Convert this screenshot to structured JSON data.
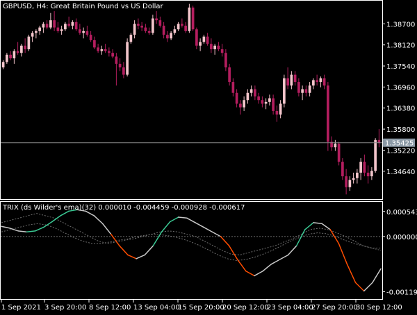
{
  "window": {
    "symbol_title": "GBPUSD, H4:  Great Britain Pound vs US Dollar",
    "indicator_title": "TRIX (ds Wilder's ema)(32) 0.000010 -0.004459 -0.000928 -0.000617"
  },
  "colors": {
    "background": "#000000",
    "frame": "#ffffff",
    "text": "#ffffff",
    "bull_candle": "#f4c6cc",
    "bear_candle": "#b51e5f",
    "bid_line": "#8c8c8c",
    "bid_label_bg": "#8c9aa6",
    "trix_up": "#3ac893",
    "trix_down": "#ff4d00",
    "trix_neutral": "#c8c8c8",
    "levels": "#6e6e6e"
  },
  "chart_data": [
    {
      "type": "candlestick",
      "title": "GBPUSD, H4:  Great Britain Pound vs US Dollar",
      "ylim": [
        1.3389,
        1.393
      ],
      "y_ticks": [
        "1.38700",
        "1.38120",
        "1.37540",
        "1.36960",
        "1.36380",
        "1.35800",
        "1.35220",
        "1.34640"
      ],
      "current_price": "1.35425",
      "candles_ohlc": [
        [
          1.375,
          1.377,
          1.3745,
          1.3765
        ],
        [
          1.3765,
          1.379,
          1.376,
          1.3785
        ],
        [
          1.3785,
          1.3795,
          1.377,
          1.3775
        ],
        [
          1.3775,
          1.38,
          1.376,
          1.3795
        ],
        [
          1.3795,
          1.382,
          1.3785,
          1.379
        ],
        [
          1.379,
          1.3815,
          1.378,
          1.381
        ],
        [
          1.381,
          1.383,
          1.379,
          1.38
        ],
        [
          1.38,
          1.384,
          1.3795,
          1.3835
        ],
        [
          1.3835,
          1.385,
          1.382,
          1.3845
        ],
        [
          1.3845,
          1.3855,
          1.383,
          1.385
        ],
        [
          1.385,
          1.3865,
          1.384,
          1.386
        ],
        [
          1.386,
          1.3875,
          1.3845,
          1.387
        ],
        [
          1.387,
          1.388,
          1.3855,
          1.386
        ],
        [
          1.386,
          1.39,
          1.3855,
          1.388
        ],
        [
          1.388,
          1.3905,
          1.385,
          1.386
        ],
        [
          1.386,
          1.3875,
          1.3845,
          1.385
        ],
        [
          1.385,
          1.3865,
          1.384,
          1.3855
        ],
        [
          1.3855,
          1.3875,
          1.385,
          1.387
        ],
        [
          1.387,
          1.389,
          1.386,
          1.3865
        ],
        [
          1.3865,
          1.388,
          1.3855,
          1.3875
        ],
        [
          1.3875,
          1.3885,
          1.385,
          1.3855
        ],
        [
          1.3855,
          1.387,
          1.384,
          1.3845
        ],
        [
          1.3845,
          1.386,
          1.383,
          1.385
        ],
        [
          1.385,
          1.3865,
          1.3835,
          1.384
        ],
        [
          1.384,
          1.385,
          1.382,
          1.3825
        ],
        [
          1.3825,
          1.3835,
          1.38,
          1.3805
        ],
        [
          1.3805,
          1.3815,
          1.379,
          1.3795
        ],
        [
          1.3795,
          1.381,
          1.3785,
          1.38
        ],
        [
          1.38,
          1.3815,
          1.379,
          1.3795
        ],
        [
          1.3795,
          1.3805,
          1.378,
          1.379
        ],
        [
          1.379,
          1.38,
          1.3775,
          1.378
        ],
        [
          1.378,
          1.379,
          1.37,
          1.376
        ],
        [
          1.376,
          1.3775,
          1.374,
          1.375
        ],
        [
          1.375,
          1.3765,
          1.372,
          1.373
        ],
        [
          1.373,
          1.383,
          1.3725,
          1.382
        ],
        [
          1.382,
          1.3845,
          1.3815,
          1.384
        ],
        [
          1.384,
          1.388,
          1.383,
          1.387
        ],
        [
          1.387,
          1.3885,
          1.3855,
          1.3865
        ],
        [
          1.3865,
          1.3875,
          1.385,
          1.386
        ],
        [
          1.386,
          1.387,
          1.3845,
          1.385
        ],
        [
          1.385,
          1.386,
          1.384,
          1.3845
        ],
        [
          1.3845,
          1.3895,
          1.384,
          1.3885
        ],
        [
          1.3885,
          1.3905,
          1.387,
          1.388
        ],
        [
          1.388,
          1.389,
          1.386,
          1.3865
        ],
        [
          1.3865,
          1.3875,
          1.383,
          1.384
        ],
        [
          1.384,
          1.385,
          1.382,
          1.383
        ],
        [
          1.383,
          1.385,
          1.3825,
          1.3845
        ],
        [
          1.3845,
          1.3865,
          1.384,
          1.3855
        ],
        [
          1.3855,
          1.3875,
          1.385,
          1.387
        ],
        [
          1.387,
          1.3885,
          1.386,
          1.3865
        ],
        [
          1.3865,
          1.3875,
          1.3845,
          1.385
        ],
        [
          1.385,
          1.3925,
          1.3845,
          1.3915
        ],
        [
          1.3915,
          1.392,
          1.385,
          1.3855
        ],
        [
          1.3855,
          1.386,
          1.38,
          1.381
        ],
        [
          1.381,
          1.383,
          1.3795,
          1.382
        ],
        [
          1.382,
          1.384,
          1.3815,
          1.3835
        ],
        [
          1.3835,
          1.3845,
          1.381,
          1.3815
        ],
        [
          1.3815,
          1.383,
          1.379,
          1.38
        ],
        [
          1.38,
          1.3815,
          1.3785,
          1.381
        ],
        [
          1.381,
          1.382,
          1.3795,
          1.38
        ],
        [
          1.38,
          1.3815,
          1.378,
          1.379
        ],
        [
          1.379,
          1.38,
          1.374,
          1.375
        ],
        [
          1.375,
          1.376,
          1.37,
          1.371
        ],
        [
          1.371,
          1.372,
          1.367,
          1.368
        ],
        [
          1.368,
          1.369,
          1.364,
          1.365
        ],
        [
          1.365,
          1.366,
          1.362,
          1.364
        ],
        [
          1.364,
          1.367,
          1.363,
          1.366
        ],
        [
          1.366,
          1.369,
          1.365,
          1.368
        ],
        [
          1.368,
          1.37,
          1.367,
          1.369
        ],
        [
          1.369,
          1.37,
          1.366,
          1.367
        ],
        [
          1.367,
          1.368,
          1.365,
          1.366
        ],
        [
          1.366,
          1.367,
          1.364,
          1.365
        ],
        [
          1.365,
          1.3665,
          1.3635,
          1.3655
        ],
        [
          1.3655,
          1.3675,
          1.3645,
          1.3665
        ],
        [
          1.3665,
          1.3675,
          1.362,
          1.363
        ],
        [
          1.363,
          1.3645,
          1.36,
          1.362
        ],
        [
          1.362,
          1.366,
          1.361,
          1.365
        ],
        [
          1.365,
          1.373,
          1.364,
          1.372
        ],
        [
          1.372,
          1.375,
          1.369,
          1.37
        ],
        [
          1.37,
          1.374,
          1.369,
          1.373
        ],
        [
          1.373,
          1.374,
          1.37,
          1.371
        ],
        [
          1.371,
          1.372,
          1.367,
          1.368
        ],
        [
          1.368,
          1.37,
          1.366,
          1.369
        ],
        [
          1.369,
          1.37,
          1.367,
          1.368
        ],
        [
          1.368,
          1.371,
          1.367,
          1.37
        ],
        [
          1.37,
          1.372,
          1.369,
          1.3715
        ],
        [
          1.3715,
          1.373,
          1.37,
          1.371
        ],
        [
          1.371,
          1.3725,
          1.3695,
          1.372
        ],
        [
          1.372,
          1.373,
          1.369,
          1.37
        ],
        [
          1.37,
          1.371,
          1.352,
          1.3545
        ],
        [
          1.3545,
          1.356,
          1.352,
          1.353
        ],
        [
          1.353,
          1.355,
          1.352,
          1.354
        ],
        [
          1.354,
          1.3545,
          1.348,
          1.349
        ],
        [
          1.349,
          1.35,
          1.344,
          1.345
        ],
        [
          1.345,
          1.347,
          1.34,
          1.342
        ],
        [
          1.342,
          1.345,
          1.341,
          1.344
        ],
        [
          1.344,
          1.346,
          1.343,
          1.3445
        ],
        [
          1.3445,
          1.347,
          1.343,
          1.346
        ],
        [
          1.346,
          1.35,
          1.344,
          1.349
        ],
        [
          1.349,
          1.351,
          1.345,
          1.346
        ],
        [
          1.346,
          1.348,
          1.343,
          1.345
        ],
        [
          1.345,
          1.3475,
          1.344,
          1.3465
        ],
        [
          1.3465,
          1.3555,
          1.346,
          1.355
        ],
        [
          1.355,
          1.358,
          1.353,
          1.3542
        ]
      ]
    },
    {
      "type": "line",
      "title": "TRIX (ds Wilder's ema)(32) 0.000010 -0.004459 -0.000928 -0.000617",
      "ylim": [
        -0.00134,
        0.00072
      ],
      "y_ticks": [
        "0.000543",
        "0.000000",
        "-0.001197"
      ],
      "series": [
        {
          "values": [
            0.00022,
            0.00018,
            0.00012,
            0.0001,
            0.00012,
            0.0002,
            0.00032,
            0.00045,
            0.00055,
            0.00058,
            0.00055,
            0.00045,
            0.00028,
            5e-05,
            -0.0002,
            -0.0004,
            -0.00048,
            -0.0004,
            -0.0002,
            0.0001,
            0.00032,
            0.00042,
            0.0004,
            0.0003,
            0.0002,
            0.0001,
            0.0,
            -0.0002,
            -0.0005,
            -0.00075,
            -0.00085,
            -0.00075,
            -0.0006,
            -0.0005,
            -0.0004,
            -0.0002,
            0.00015,
            0.0003,
            0.00028,
            0.00015,
            -0.00015,
            -0.0006,
            -0.001,
            -0.00118,
            -0.001,
            -0.0007
          ]
        },
        {
          "values": [
            0.0003,
            0.00035,
            0.0004,
            0.00045,
            0.0005,
            0.00045,
            0.0004,
            0.0003,
            0.0002,
            0.0001,
            0.0,
            -0.0001,
            -0.00015,
            -0.00012,
            -8e-05,
            -5e-05,
            0.0,
            5e-05,
            0.0001,
            0.00012,
            0.0001,
            5e-05,
            0.0,
            -0.0001,
            -0.0002,
            -0.0003,
            -0.00038,
            -0.0004,
            -0.00035,
            -0.0003,
            -0.00025,
            -0.0002,
            -0.00012,
            -5e-05,
            5e-05,
            0.00015,
            0.00018,
            0.00015,
            8e-05,
            0.0,
            -0.0001,
            -0.0002,
            -0.00025,
            -0.00025
          ]
        },
        {
          "values": [
            0.0001,
            0.00015,
            0.0002,
            0.00025,
            0.00028,
            0.00025,
            0.00018,
            8e-05,
            -2e-05,
            -0.0001,
            -0.00015,
            -0.00015,
            -0.00012,
            -8e-05,
            -5e-05,
            0.0,
            3e-05,
            5e-05,
            3e-05,
            0.0,
            -5e-05,
            -0.00012,
            -0.0002,
            -0.0003,
            -0.0004,
            -0.00048,
            -0.00052,
            -0.0005,
            -0.00045,
            -0.00038,
            -0.0003,
            -0.0002,
            -0.0001,
            -2e-05,
            5e-05,
            8e-05,
            6e-05,
            0.0,
            -8e-05,
            -0.00015,
            -0.0002,
            -0.00025,
            -0.0003
          ]
        }
      ],
      "zero_level": 0.0
    }
  ],
  "x_axis": {
    "labels": [
      "1 Sep 2021",
      "3 Sep 20:00",
      "8 Sep 12:00",
      "13 Sep 04:00",
      "15 Sep 20:00",
      "20 Sep 12:00",
      "23 Sep 04:00",
      "27 Sep 20:00",
      "30 Sep 12:00"
    ]
  }
}
